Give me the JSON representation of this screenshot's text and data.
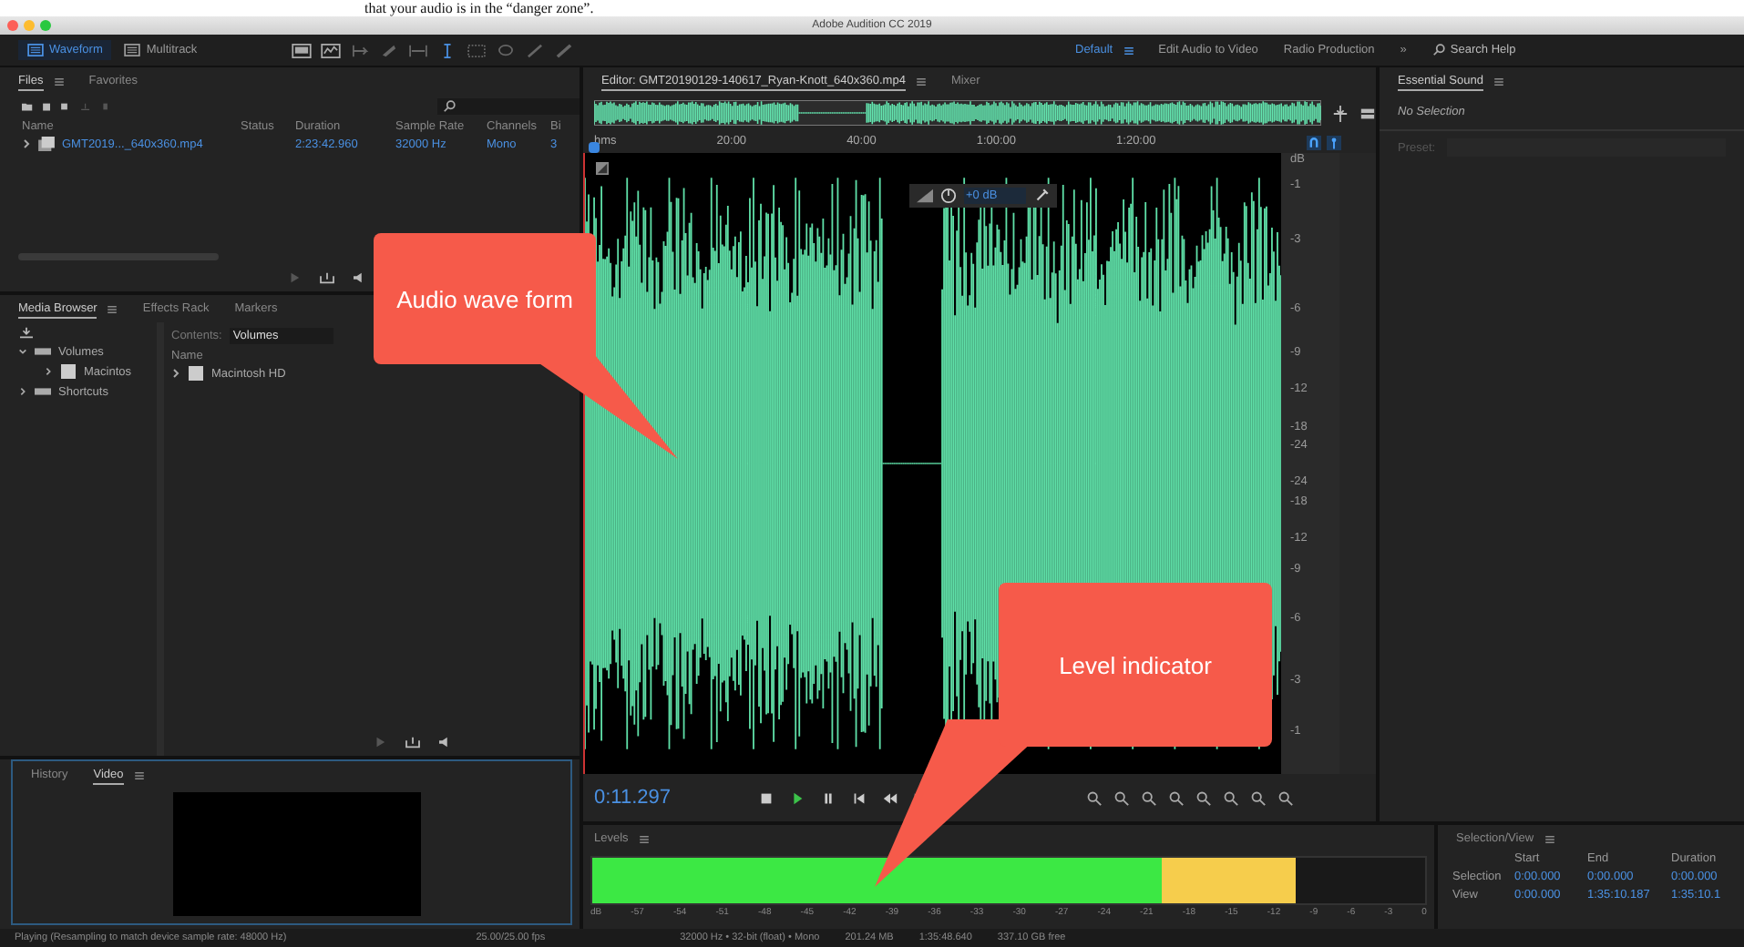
{
  "caption": "that your audio is in the “danger zone”.",
  "window": {
    "title": "Adobe Audition CC 2019"
  },
  "toolbar": {
    "views": [
      {
        "label": "Waveform",
        "selected": true
      },
      {
        "label": "Multitrack",
        "selected": false
      }
    ],
    "workspaces": [
      {
        "label": "Default",
        "selected": true
      },
      {
        "label": "Edit Audio to Video",
        "selected": false
      },
      {
        "label": "Radio Production",
        "selected": false
      }
    ],
    "overflow": "»",
    "search": {
      "placeholder": "Search Help"
    }
  },
  "files_panel": {
    "tabs": [
      {
        "label": "Files",
        "selected": true
      },
      {
        "label": "Favorites",
        "selected": false
      }
    ],
    "columns": [
      "Name",
      "Status",
      "Duration",
      "Sample Rate",
      "Channels",
      "Bi"
    ],
    "rows": [
      {
        "name": "GMT2019..._640x360.mp4",
        "duration": "2:23:42.960",
        "sample_rate": "32000 Hz",
        "channels": "Mono",
        "bits": "3"
      }
    ]
  },
  "media_browser": {
    "tabs": [
      {
        "label": "Media Browser",
        "selected": true
      },
      {
        "label": "Effects Rack",
        "selected": false
      },
      {
        "label": "Markers",
        "selected": false
      }
    ],
    "contents_label": "Contents:",
    "contents_value": "Volumes",
    "tree": [
      {
        "label": "Volumes",
        "expanded": true,
        "children": [
          {
            "label": "Macintos",
            "expanded": false
          }
        ]
      },
      {
        "label": "Shortcuts",
        "expanded": false
      }
    ],
    "list_header": "Name",
    "list": [
      {
        "label": "Macintosh HD"
      }
    ]
  },
  "video_panel": {
    "tabs": [
      {
        "label": "History",
        "selected": false
      },
      {
        "label": "Video",
        "selected": true
      }
    ]
  },
  "editor": {
    "tabs": [
      {
        "label": "Editor: GMT20190129-140617_Ryan-Knott_640x360.mp4",
        "selected": true
      },
      {
        "label": "Mixer",
        "selected": false
      }
    ],
    "ruler": [
      "hms",
      "20:00",
      "40:00",
      "1:00:00",
      "1:20:00"
    ],
    "db_scale": [
      "dB",
      "-1",
      "-3",
      "-6",
      "-9",
      "-12",
      "-18",
      "-24",
      "-24",
      "-18",
      "-12",
      "-9",
      "-6",
      "-3",
      "-1"
    ],
    "hud_gain": "+0 dB",
    "time": "0:11.297"
  },
  "essential_sound": {
    "title": "Essential Sound",
    "status": "No Selection",
    "preset_label": "Preset:"
  },
  "levels": {
    "title": "Levels",
    "level": 0.845,
    "scale": [
      "dB",
      "-57",
      "-54",
      "-51",
      "-48",
      "-45",
      "-42",
      "-39",
      "-36",
      "-33",
      "-30",
      "-27",
      "-24",
      "-21",
      "-18",
      "-15",
      "-12",
      "-9",
      "-6",
      "-3",
      "0"
    ]
  },
  "selection_view": {
    "title": "Selection/View",
    "columns": [
      "Start",
      "End",
      "Duration"
    ],
    "rows": [
      {
        "label": "Selection",
        "values": [
          "0:00.000",
          "0:00.000",
          "0:00.000"
        ]
      },
      {
        "label": "View",
        "values": [
          "0:00.000",
          "1:35:10.187",
          "1:35:10.1"
        ]
      }
    ]
  },
  "status_bar": [
    "Playing (Resampling to match device sample rate: 48000 Hz)",
    "25.00/25.00 fps",
    "32000 Hz • 32-bit (float) • Mono",
    "201.24 MB",
    "1:35:48.640",
    "337.10 GB free"
  ],
  "callouts": [
    {
      "text": "Audio wave form"
    },
    {
      "text": "Level indicator"
    }
  ]
}
